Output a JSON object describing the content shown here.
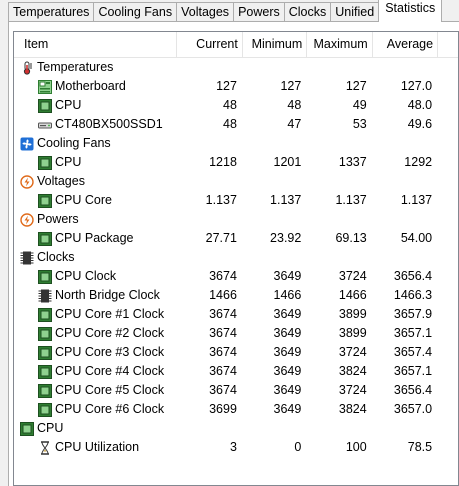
{
  "tabs": [
    {
      "label": "Temperatures",
      "active": false
    },
    {
      "label": "Cooling Fans",
      "active": false
    },
    {
      "label": "Voltages",
      "active": false
    },
    {
      "label": "Powers",
      "active": false
    },
    {
      "label": "Clocks",
      "active": false
    },
    {
      "label": "Unified",
      "active": false
    },
    {
      "label": "Statistics",
      "active": true
    }
  ],
  "table": {
    "columns": [
      "Item",
      "Current",
      "Minimum",
      "Maximum",
      "Average"
    ],
    "rows": [
      {
        "type": "group",
        "label": "Temperatures",
        "icon": "thermometer-icon"
      },
      {
        "type": "item",
        "label": "Motherboard",
        "icon": "motherboard-icon",
        "current": "127",
        "minimum": "127",
        "maximum": "127",
        "average": "127.0"
      },
      {
        "type": "item",
        "label": "CPU",
        "icon": "cpu-chip-icon",
        "current": "48",
        "minimum": "48",
        "maximum": "49",
        "average": "48.0"
      },
      {
        "type": "item",
        "label": "CT480BX500SSD1",
        "icon": "drive-icon",
        "current": "48",
        "minimum": "47",
        "maximum": "53",
        "average": "49.6"
      },
      {
        "type": "group",
        "label": "Cooling Fans",
        "icon": "fan-icon"
      },
      {
        "type": "item",
        "label": "CPU",
        "icon": "cpu-chip-icon",
        "current": "1218",
        "minimum": "1201",
        "maximum": "1337",
        "average": "1292"
      },
      {
        "type": "group",
        "label": "Voltages",
        "icon": "voltage-icon"
      },
      {
        "type": "item",
        "label": "CPU Core",
        "icon": "cpu-chip-icon",
        "current": "1.137",
        "minimum": "1.137",
        "maximum": "1.137",
        "average": "1.137"
      },
      {
        "type": "group",
        "label": "Powers",
        "icon": "power-icon"
      },
      {
        "type": "item",
        "label": "CPU Package",
        "icon": "cpu-chip-icon",
        "current": "27.71",
        "minimum": "23.92",
        "maximum": "69.13",
        "average": "54.00"
      },
      {
        "type": "group",
        "label": "Clocks",
        "icon": "clock-chip-icon"
      },
      {
        "type": "item",
        "label": "CPU Clock",
        "icon": "cpu-chip-icon",
        "current": "3674",
        "minimum": "3649",
        "maximum": "3724",
        "average": "3656.4"
      },
      {
        "type": "item",
        "label": "North Bridge Clock",
        "icon": "chipset-icon",
        "current": "1466",
        "minimum": "1466",
        "maximum": "1466",
        "average": "1466.3"
      },
      {
        "type": "item",
        "label": "CPU Core #1 Clock",
        "icon": "cpu-chip-icon",
        "current": "3674",
        "minimum": "3649",
        "maximum": "3899",
        "average": "3657.9"
      },
      {
        "type": "item",
        "label": "CPU Core #2 Clock",
        "icon": "cpu-chip-icon",
        "current": "3674",
        "minimum": "3649",
        "maximum": "3899",
        "average": "3657.1"
      },
      {
        "type": "item",
        "label": "CPU Core #3 Clock",
        "icon": "cpu-chip-icon",
        "current": "3674",
        "minimum": "3649",
        "maximum": "3724",
        "average": "3657.4"
      },
      {
        "type": "item",
        "label": "CPU Core #4 Clock",
        "icon": "cpu-chip-icon",
        "current": "3674",
        "minimum": "3649",
        "maximum": "3824",
        "average": "3657.1"
      },
      {
        "type": "item",
        "label": "CPU Core #5 Clock",
        "icon": "cpu-chip-icon",
        "current": "3674",
        "minimum": "3649",
        "maximum": "3724",
        "average": "3656.4"
      },
      {
        "type": "item",
        "label": "CPU Core #6 Clock",
        "icon": "cpu-chip-icon",
        "current": "3699",
        "minimum": "3649",
        "maximum": "3824",
        "average": "3657.0"
      },
      {
        "type": "group",
        "label": "CPU",
        "icon": "cpu-chip-icon"
      },
      {
        "type": "item",
        "label": "CPU Utilization",
        "icon": "hourglass-icon",
        "current": "3",
        "minimum": "0",
        "maximum": "100",
        "average": "78.5"
      }
    ]
  },
  "colors": {
    "chip_green": "#2f7d32",
    "chip_green_light": "#8fd18f",
    "fan_blue": "#1f6fd6",
    "power_orange": "#e06a1a"
  }
}
